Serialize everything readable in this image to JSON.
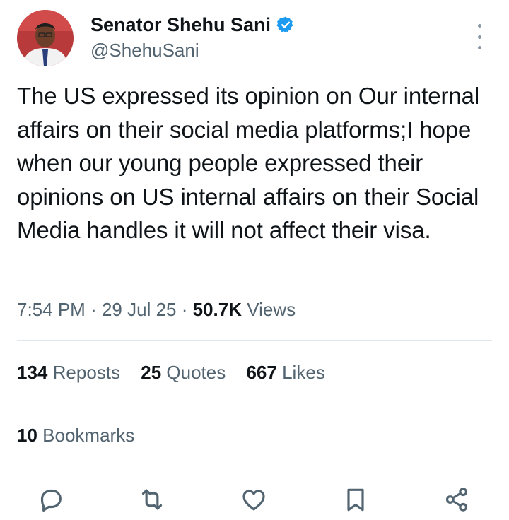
{
  "author": {
    "display_name": "Senator Shehu Sani",
    "handle": "@ShehuSani"
  },
  "tweet": {
    "text": "The US expressed its opinion on Our internal affairs on their social media platforms;I hope when our young people expressed their opinions on US internal affairs on their Social Media handles it will not affect their visa.",
    "time": "7:54 PM",
    "separator": "·",
    "date": "29 Jul 25",
    "views_count": "50.7K",
    "views_label": "Views"
  },
  "stats": {
    "reposts_count": "134",
    "reposts_label": "Reposts",
    "quotes_count": "25",
    "quotes_label": "Quotes",
    "likes_count": "667",
    "likes_label": "Likes",
    "bookmarks_count": "10",
    "bookmarks_label": "Bookmarks"
  },
  "icons": {
    "verified": "verified-badge-icon",
    "more": "more-options-icon",
    "reply": "reply-icon",
    "repost": "repost-icon",
    "like": "like-icon",
    "bookmark": "bookmark-icon",
    "share": "share-icon"
  },
  "colors": {
    "verified_blue": "#1d9bf0",
    "secondary_text": "#536471",
    "primary_text": "#0f1419",
    "divider": "#e1e6ea"
  }
}
